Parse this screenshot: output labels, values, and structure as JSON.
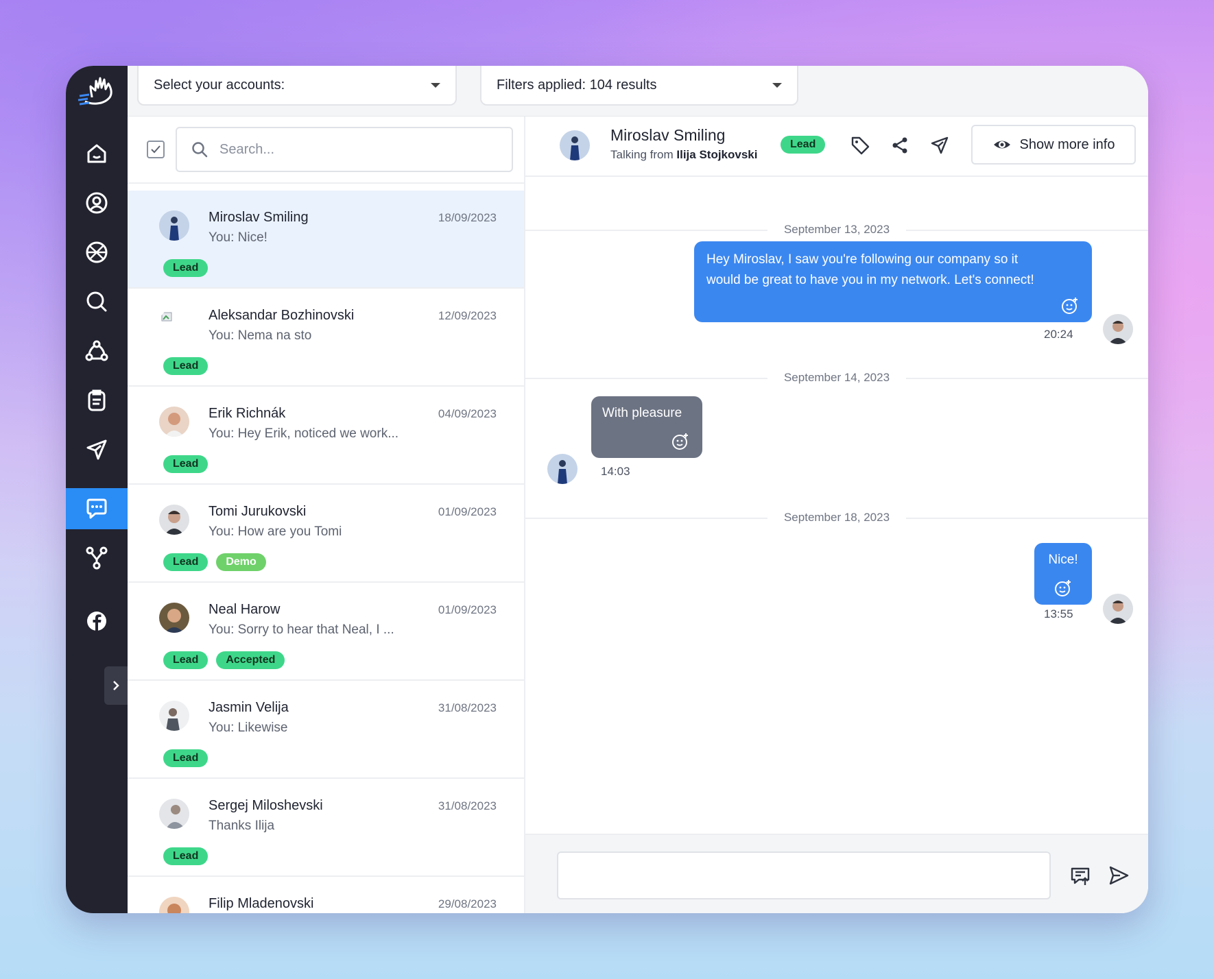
{
  "colors": {
    "accent": "#3b87f0",
    "rail": "#22232f",
    "tag_green": "#3ed78a"
  },
  "topbar": {
    "accounts_label": "Select your accounts:",
    "filters_label": "Filters applied: 104 results"
  },
  "search": {
    "placeholder": "Search..."
  },
  "nav": [
    "home-icon",
    "user-icon",
    "globe-icon",
    "search-icon",
    "network-icon",
    "clipboard-icon",
    "send-icon",
    "chat-icon",
    "integrations-icon",
    "facebook-icon"
  ],
  "conversations": [
    {
      "name": "Miroslav Smiling",
      "date": "18/09/2023",
      "preview": "You: Nice!",
      "tags": [
        "Lead"
      ]
    },
    {
      "name": "Aleksandar Bozhinovski",
      "date": "12/09/2023",
      "preview": "You: Nema na sto",
      "tags": [
        "Lead"
      ]
    },
    {
      "name": "Erik Richnák",
      "date": "04/09/2023",
      "preview": "You: Hey Erik, noticed we work...",
      "tags": [
        "Lead"
      ]
    },
    {
      "name": "Tomi Jurukovski",
      "date": "01/09/2023",
      "preview": "You: How are you Tomi",
      "tags": [
        "Lead",
        "Demo"
      ]
    },
    {
      "name": "Neal Harow",
      "date": "01/09/2023",
      "preview": "You: Sorry to hear that Neal, I ...",
      "tags": [
        "Lead",
        "Accepted"
      ]
    },
    {
      "name": "Jasmin Velija",
      "date": "31/08/2023",
      "preview": "You: Likewise",
      "tags": [
        "Lead"
      ]
    },
    {
      "name": "Sergej Miloshevski",
      "date": "31/08/2023",
      "preview": "Thanks Ilija",
      "tags": [
        "Lead"
      ]
    },
    {
      "name": "Filip Mladenovski",
      "date": "29/08/2023",
      "preview": "",
      "tags": []
    }
  ],
  "chat": {
    "contact_name": "Miroslav Smiling",
    "talking_from_prefix": "Talking from",
    "talking_from_name": "Ilija Stojkovski",
    "tag": "Lead",
    "show_more_label": "Show more info",
    "days": [
      "September 13, 2023",
      "September 14, 2023",
      "September 18, 2023"
    ],
    "messages": [
      {
        "dir": "out",
        "text_line1": "Hey Miroslav, I saw you're following our company so it",
        "text_line2": "would be great to have you in my network. Let's connect!",
        "time": "20:24"
      },
      {
        "dir": "in",
        "text": "With pleasure",
        "time": "14:03"
      },
      {
        "dir": "out",
        "text": "Nice!",
        "time": "13:55"
      }
    ],
    "composer_value": ""
  }
}
